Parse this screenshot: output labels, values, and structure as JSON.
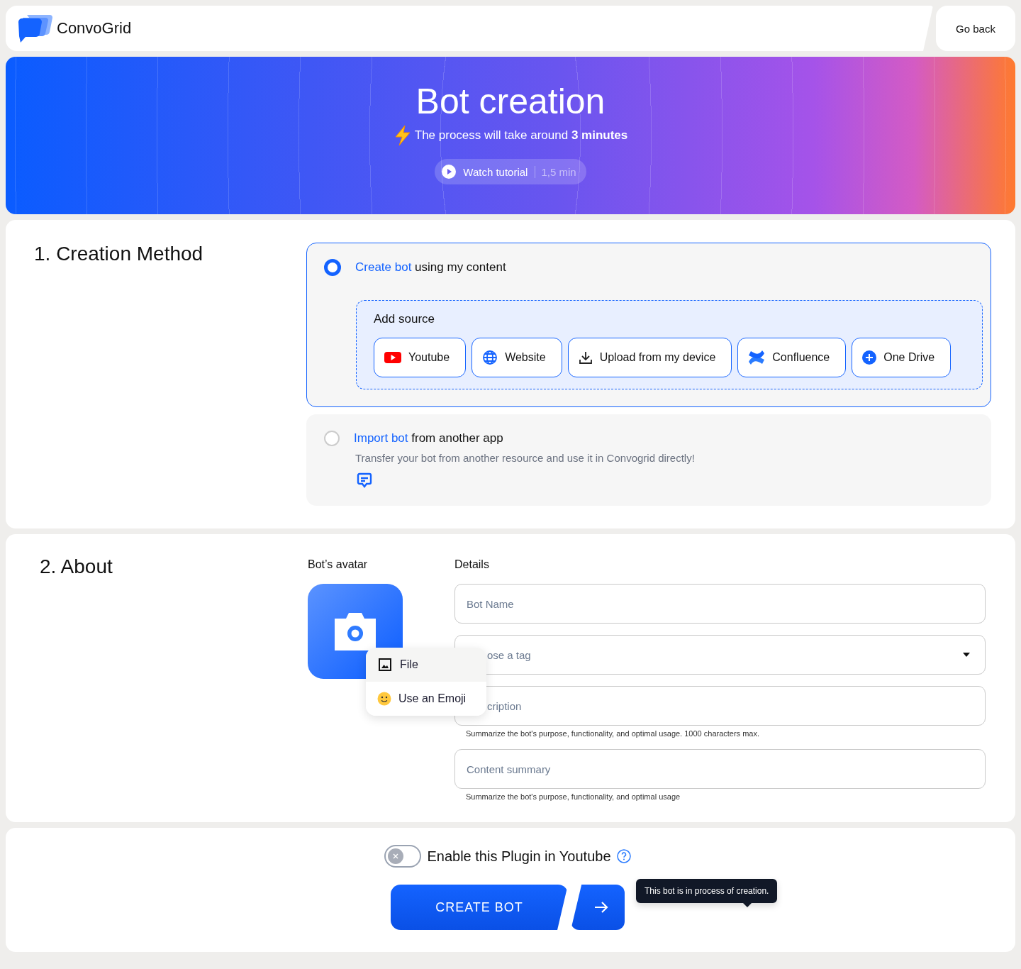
{
  "header": {
    "brand": "ConvoGrid",
    "back": "Go back"
  },
  "hero": {
    "title": "Bot creation",
    "subtitle": "The process will take around **3 minutes**",
    "tutorial": "Watch tutorial",
    "duration": "1,5 min"
  },
  "creation": {
    "title": "1. Creation Method",
    "options": [
      {
        "highlight": "Create bot",
        "rest": "using my content",
        "selected": true
      },
      {
        "highlight": "Import bot",
        "rest": "from another app",
        "selected": false,
        "description": "Transfer your bot from another resource and use it in Convogrid directly!"
      }
    ],
    "source_title": "Add source",
    "sources": [
      {
        "kind": "youtube",
        "label": "Youtube"
      },
      {
        "kind": "website",
        "label": "Website"
      },
      {
        "kind": "upload",
        "label": "Upload from my device"
      },
      {
        "kind": "confluence",
        "label": "Confluence"
      },
      {
        "kind": "onedrive",
        "label": "One Drive"
      }
    ]
  },
  "about": {
    "title": "2. About",
    "avatar_label": "Bot’s avatar",
    "details_label": "Details",
    "menu": [
      {
        "kind": "file",
        "label": "File"
      },
      {
        "kind": "emoji",
        "label": "Use an Emoji"
      }
    ],
    "fields": [
      {
        "kind": "text",
        "placeholder": "Bot Name"
      },
      {
        "kind": "select",
        "placeholder": "ose a tag",
        "covered": true
      },
      {
        "kind": "text",
        "placeholder": "cription",
        "covered": true,
        "hint": "Summarize the bot's purpose, functionality, and optimal usage. 1000 characters max."
      },
      {
        "kind": "text",
        "placeholder": "Content summary",
        "hint": "Summarize the bot's purpose, functionality, and optimal usage"
      }
    ]
  },
  "footer": {
    "toggle_label": "Enable this Plugin in Youtube",
    "on": false,
    "create": "CREATE BOT",
    "tooltip": "This bot is in process of creation."
  }
}
